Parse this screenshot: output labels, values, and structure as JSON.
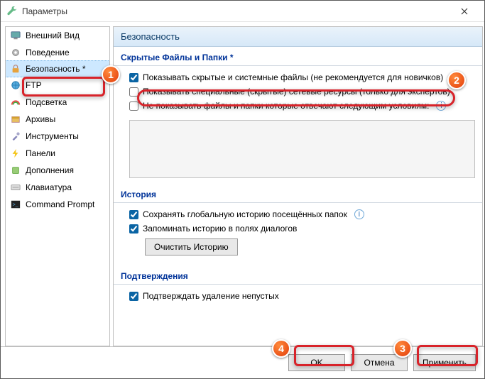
{
  "window": {
    "title": "Параметры"
  },
  "sidebar": {
    "items": [
      {
        "label": "Внешний Вид"
      },
      {
        "label": "Поведение"
      },
      {
        "label": "Безопасность *"
      },
      {
        "label": "FTP"
      },
      {
        "label": "Подсветка"
      },
      {
        "label": "Архивы"
      },
      {
        "label": "Инструменты"
      },
      {
        "label": "Панели"
      },
      {
        "label": "Дополнения"
      },
      {
        "label": "Клавиатура"
      },
      {
        "label": "Command Prompt"
      }
    ]
  },
  "panel": {
    "title": "Безопасность",
    "sections": {
      "hidden": {
        "title": "Скрытые Файлы и Папки *",
        "opt1": "Показывать скрытые и системные файлы (не рекомендуется для новичков)",
        "opt2": "Показывать специальные (скрытые) сетевые ресурсы (только для экспертов)",
        "opt3": "Не показывать файлы и папки которые отвечают следующим условиям:"
      },
      "history": {
        "title": "История",
        "opt1": "Сохранять глобальную историю посещённых папок",
        "opt2": "Запоминать историю в полях диалогов",
        "clear_btn": "Очистить Историю"
      },
      "confirm": {
        "title": "Подтверждения",
        "opt1": "Подтверждать удаление непустых"
      }
    }
  },
  "footer": {
    "ok": "OK",
    "cancel": "Отмена",
    "apply": "Применить"
  },
  "callouts": {
    "c1": "1",
    "c2": "2",
    "c3": "3",
    "c4": "4"
  }
}
